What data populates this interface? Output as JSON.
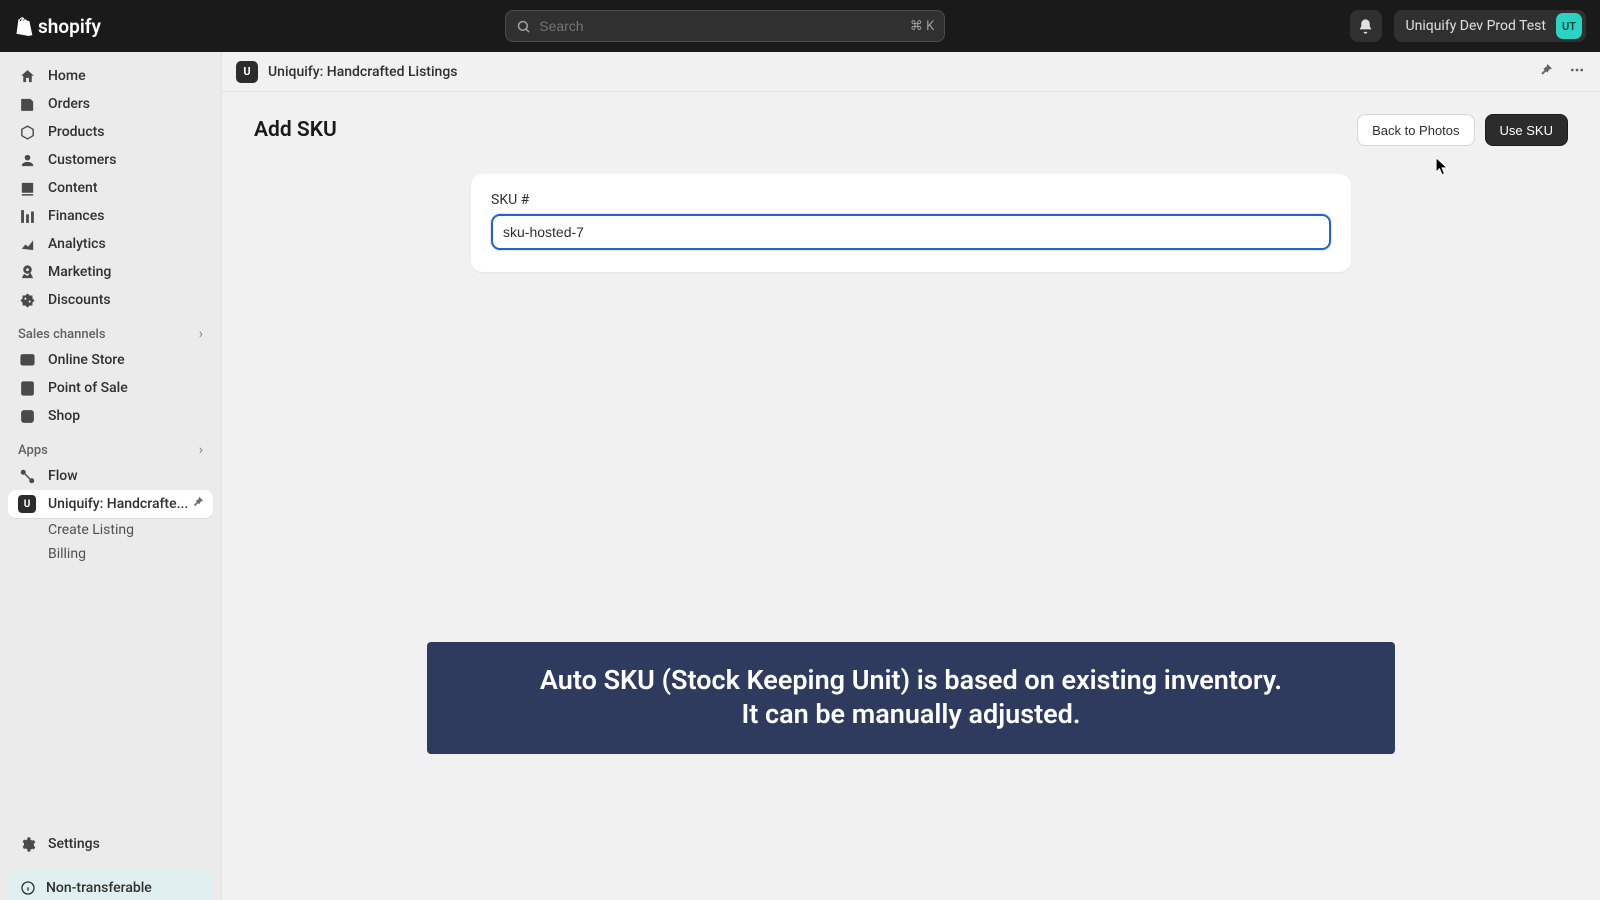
{
  "topbar": {
    "logo_text": "shopify",
    "search_placeholder": "Search",
    "search_kbd": "⌘ K",
    "store_name": "Uniquify Dev Prod Test",
    "avatar_initials": "UT"
  },
  "sidebar": {
    "nav": [
      {
        "label": "Home",
        "icon": "home"
      },
      {
        "label": "Orders",
        "icon": "orders"
      },
      {
        "label": "Products",
        "icon": "products"
      },
      {
        "label": "Customers",
        "icon": "customers"
      },
      {
        "label": "Content",
        "icon": "content"
      },
      {
        "label": "Finances",
        "icon": "finances"
      },
      {
        "label": "Analytics",
        "icon": "analytics"
      },
      {
        "label": "Marketing",
        "icon": "marketing"
      },
      {
        "label": "Discounts",
        "icon": "discounts"
      }
    ],
    "sales_channels_label": "Sales channels",
    "channels": [
      {
        "label": "Online Store",
        "icon": "online-store"
      },
      {
        "label": "Point of Sale",
        "icon": "pos"
      },
      {
        "label": "Shop",
        "icon": "shop"
      }
    ],
    "apps_label": "Apps",
    "apps": [
      {
        "label": "Flow",
        "icon": "flow"
      }
    ],
    "active_app": {
      "label": "Uniquify: Handcrafte...",
      "subitems": [
        {
          "label": "Create Listing"
        },
        {
          "label": "Billing"
        }
      ]
    },
    "settings_label": "Settings",
    "nontransferable_label": "Non-transferable"
  },
  "appbar": {
    "title": "Uniquify: Handcrafted Listings"
  },
  "page": {
    "title": "Add SKU",
    "back_button": "Back to Photos",
    "primary_button": "Use SKU",
    "field_label": "SKU #",
    "sku_value": "sku-hosted-7",
    "callout_line1": "Auto SKU (Stock Keeping Unit) is based on existing inventory.",
    "callout_line2": "It can be manually adjusted."
  }
}
